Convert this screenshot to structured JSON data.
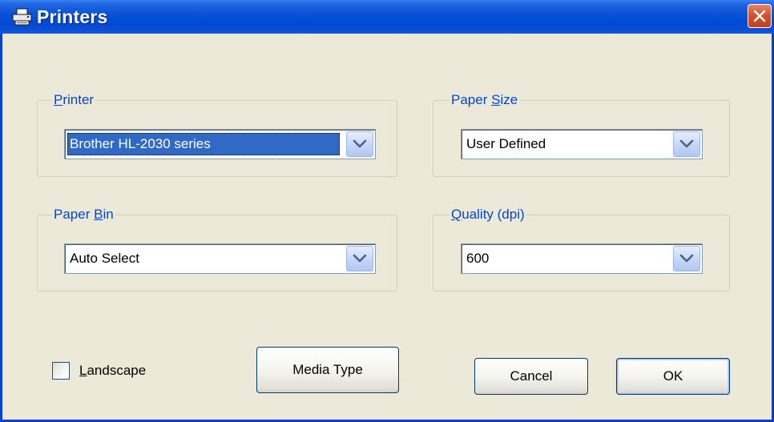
{
  "window": {
    "title": "Printers",
    "icon": "printer-icon",
    "close_icon": "close-icon"
  },
  "colors": {
    "titlebar": "#0049d3",
    "face": "#ece9d8",
    "group_label": "#0046d5",
    "selection": "#316ac5",
    "close_button": "#d6502d"
  },
  "printer": {
    "label_mnemonic": "P",
    "label_rest": "rinter",
    "value": "Brother HL-2030 series"
  },
  "paper_size": {
    "label_pre": "Paper ",
    "label_mnemonic": "S",
    "label_post": "ize",
    "value": "User Defined"
  },
  "paper_bin": {
    "label_pre": "Paper ",
    "label_mnemonic": "B",
    "label_post": "in",
    "value": "Auto Select"
  },
  "quality": {
    "label_mnemonic": "Q",
    "label_rest": "uality (dpi)",
    "value": "600"
  },
  "landscape": {
    "label_mnemonic": "L",
    "label_rest": "andscape",
    "checked": false
  },
  "buttons": {
    "media_type": "Media Type",
    "cancel": "Cancel",
    "ok": "OK"
  }
}
